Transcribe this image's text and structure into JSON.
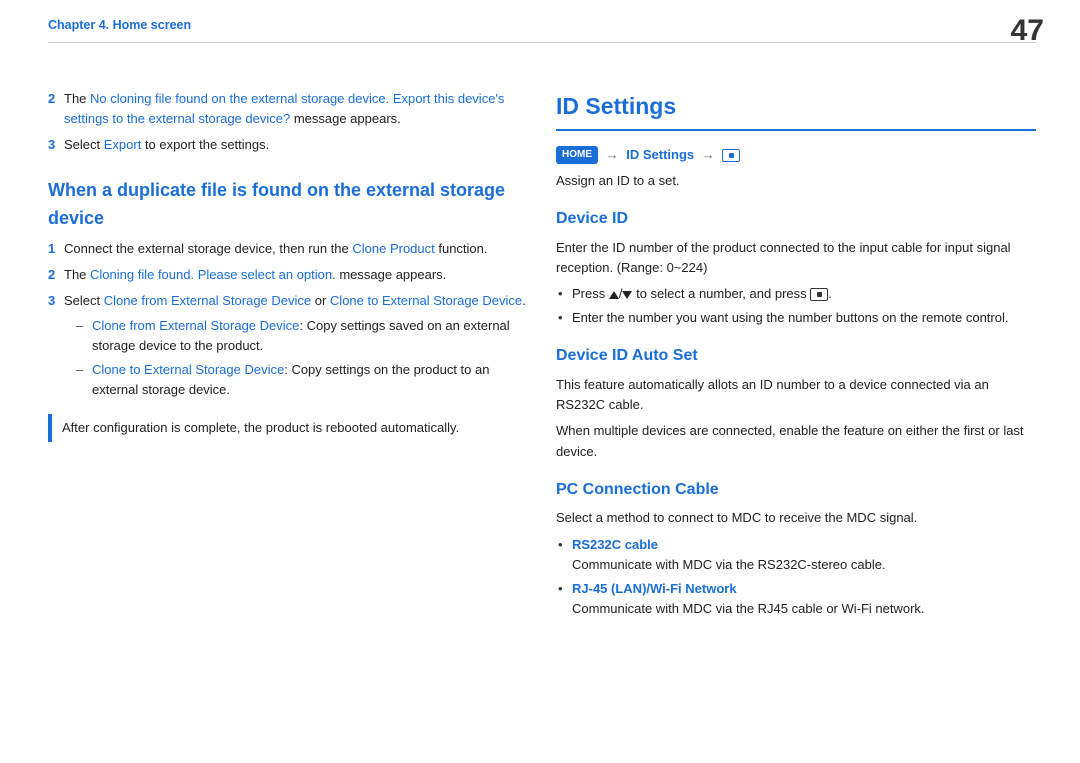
{
  "header": {
    "chapter": "Chapter 4. Home screen",
    "page_number": "47"
  },
  "left": {
    "s1": {
      "n2": "2",
      "t2a": "The ",
      "t2b": "No cloning file found on the external storage device. Export this device's settings to the external storage device?",
      "t2c": " message appears.",
      "n3": "3",
      "t3a": "Select ",
      "t3b": "Export",
      "t3c": " to export the settings."
    },
    "h2": "When a duplicate file is found on the external storage device",
    "s2": {
      "n1": "1",
      "t1a": "Connect the external storage device, then run the ",
      "t1b": "Clone Product",
      "t1c": " function.",
      "n2": "2",
      "t2a": "The ",
      "t2b": "Cloning file found. Please select an option.",
      "t2c": " message appears.",
      "n3": "3",
      "t3a": "Select ",
      "t3b": "Clone from External Storage Device",
      "t3c": " or ",
      "t3d": "Clone to External Storage Device",
      "t3e": ".",
      "d1a": "Clone from External Storage Device",
      "d1b": ": Copy settings saved on an external storage device to the product.",
      "d2a": "Clone to External Storage Device",
      "d2b": ": Copy settings on the product to an external storage device."
    },
    "note": "After configuration is complete, the product is rebooted automatically."
  },
  "right": {
    "h1": "ID Settings",
    "path": {
      "home": "HOME",
      "a1": "→",
      "mid": "ID Settings",
      "a2": "→"
    },
    "intro": "Assign an ID to a set.",
    "dev": {
      "h": "Device ID",
      "t1": "Enter the ID number of the product connected to the input cable for input signal reception. (Range: 0~224)",
      "b1a": "Press ",
      "b1b": " to select a number, and press ",
      "b1c": ".",
      "slash": "/",
      "b2": "Enter the number you want using the number buttons on the remote control."
    },
    "auto": {
      "h": "Device ID Auto Set",
      "t1": "This feature automatically allots an ID number to a device connected via an RS232C cable.",
      "t2": "When multiple devices are connected, enable the feature on either the first or last device."
    },
    "pc": {
      "h": "PC Connection Cable",
      "t1": "Select a method to connect to MDC to receive the MDC signal.",
      "o1": "RS232C cable",
      "o1d": "Communicate with MDC via the RS232C-stereo cable.",
      "o2": "RJ-45 (LAN)/Wi-Fi Network",
      "o2d": "Communicate with MDC via the RJ45 cable or Wi-Fi network."
    }
  }
}
